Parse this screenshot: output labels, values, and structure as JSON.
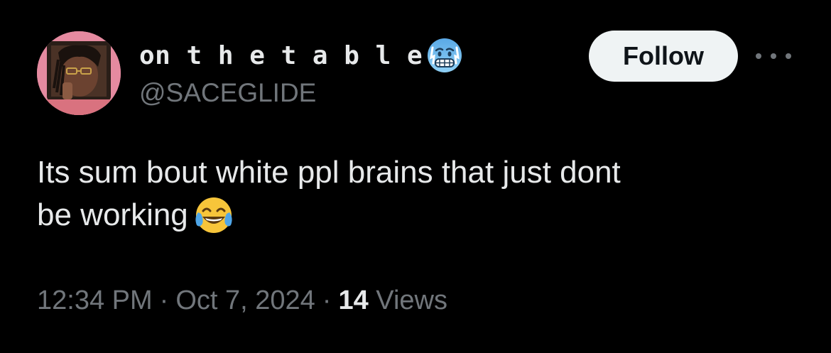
{
  "author": {
    "display_name": "on t h e t a b l e",
    "display_emoji": "cold-face-emoji",
    "handle": "@SACEGLIDE"
  },
  "actions": {
    "follow_label": "Follow",
    "more_icon": "more-horizontal-icon"
  },
  "tweet": {
    "text_line_1": "Its sum bout white ppl brains that just dont",
    "text_line_2": "be working",
    "trailing_emoji": "face-with-tears-of-joy-emoji"
  },
  "meta": {
    "time": "12:34 PM",
    "separator": "·",
    "date": "Oct 7, 2024",
    "views_count": "14",
    "views_label": "Views"
  },
  "colors": {
    "background": "#000000",
    "primary_text": "#e7e9ea",
    "secondary_text": "#71767b",
    "follow_button_bg": "#eff3f4",
    "follow_button_text": "#0f1419",
    "avatar_ring": "#e58aa0"
  }
}
